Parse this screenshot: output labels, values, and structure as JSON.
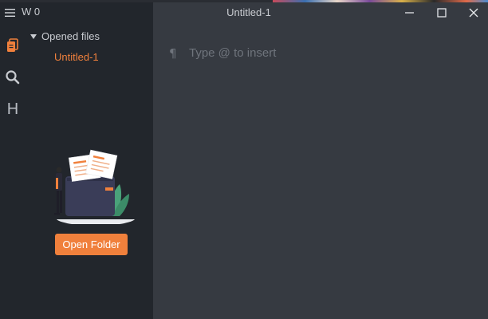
{
  "window": {
    "title": "Untitled-1",
    "controls": [
      "minimize",
      "maximize",
      "close"
    ]
  },
  "activity_bar": {
    "menu_icon": "hamburger-menu-icon",
    "items": [
      {
        "name": "files",
        "icon": "files-icon",
        "active": true
      },
      {
        "name": "search",
        "icon": "search-icon",
        "active": false
      },
      {
        "name": "headings",
        "icon": "heading-icon",
        "label": "H",
        "active": false
      }
    ]
  },
  "sidebar": {
    "word_count": "W 0",
    "section_label": "Opened files",
    "files": [
      {
        "name": "Untitled-1",
        "active": true
      }
    ],
    "open_folder_label": "Open Folder"
  },
  "editor": {
    "pilcrow": "¶",
    "placeholder": "Type @ to insert"
  },
  "colors": {
    "accent": "#f0803c",
    "sidebar_bg": "#22262c",
    "editor_bg": "#363a41",
    "text": "#c9ccd1",
    "muted": "#6f747c"
  }
}
